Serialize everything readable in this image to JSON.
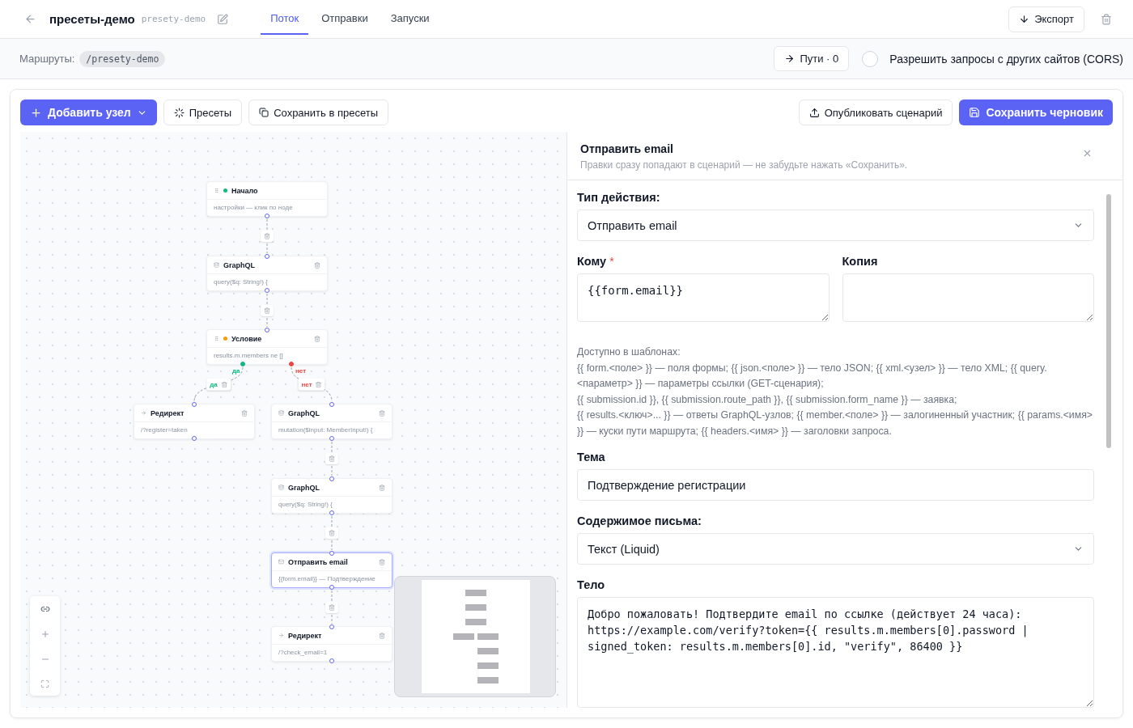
{
  "header": {
    "title": "пресеты-демо",
    "slug": "presety-demo",
    "tabs": [
      {
        "label": "Поток",
        "selected": true
      },
      {
        "label": "Отправки",
        "selected": false
      },
      {
        "label": "Запуски",
        "selected": false
      }
    ],
    "export_button": "Экспорт"
  },
  "routes": {
    "label": "Маршруты:",
    "route": "/presety-demo",
    "paths_button": "Пути · 0",
    "cors": {
      "label": "Разрешить запросы с других сайтов (CORS)",
      "checked": false
    }
  },
  "toolbar": {
    "add_node": "Добавить узел",
    "presets": "Пресеты",
    "save_presets": "Сохранить в пресеты",
    "publish": "Опубликовать сценарий",
    "save_draft": "Сохранить черновик"
  },
  "canvas": {
    "nodes": [
      {
        "kind": "start",
        "title": "Начало",
        "subtitle": "настройки — клик по ноде",
        "color": "#10b981",
        "selected": false
      },
      {
        "kind": "graphql",
        "title": "GraphQL",
        "subtitle": "query($q: String!) {",
        "selected": false
      },
      {
        "kind": "condition",
        "title": "Условие",
        "subtitle": "results.m.members ne []",
        "color": "#f59e0b",
        "selected": false
      },
      {
        "kind": "redirect",
        "title": "Редирект",
        "subtitle": "/?register=taken",
        "selected": false
      },
      {
        "kind": "graphql",
        "title": "GraphQL",
        "subtitle": "mutation($input: MemberInput!) {",
        "selected": false
      },
      {
        "kind": "graphql",
        "title": "GraphQL",
        "subtitle": "query($q: String!) {",
        "selected": false
      },
      {
        "kind": "email",
        "title": "Отправить email",
        "subtitle": "{{form.email}} — Подтверждение",
        "selected": true
      },
      {
        "kind": "redirect",
        "title": "Редирект",
        "subtitle": "/?check_email=1",
        "selected": false
      }
    ],
    "branches": [
      {
        "handle_label": "да",
        "edge_label": "да",
        "color": "#10b981"
      },
      {
        "handle_label": "нет",
        "edge_label": "нет",
        "color": "#ef4444"
      }
    ]
  },
  "panel": {
    "title": "Отправить email",
    "hint": "Правки сразу попадают в сценарий — не забудьте нажать «Сохранить».",
    "action_label": "Тип действия:",
    "action_value": "Отправить email",
    "to_label": "Кому",
    "to_required_mark": "*",
    "to_value": "{{form.email}}",
    "cc_label": "Копия",
    "help_title": "Доступно в шаблонах:",
    "help_lines": [
      "{{ form.<поле> }} — поля формы; {{ json.<поле> }} — тело JSON; {{ xml.<узел> }} — тело XML; {{ query.<параметр> }} — параметры ссылки (GET-сценария);",
      "{{ submission.id }}, {{ submission.route_path }}, {{ submission.form_name }} — заявка;",
      "{{ results.<ключ>... }} — ответы GraphQL-узлов; {{ member.<поле> }} — залогиненный участник; {{ params.<имя> }} — куски пути маршрута; {{ headers.<имя> }} — заголовки запроса."
    ],
    "subject_label": "Тема",
    "subject_value": "Подтверждение регистрации",
    "content_label": "Содержимое письма:",
    "content_value": "Текст (Liquid)",
    "body_label": "Тело",
    "body_value": "Добро пожаловать! Подтвердите email по ссылке (действует 24 часа):\nhttps://example.com/verify?token={{ results.m.members[0].password | signed_token: results.m.members[0].id, \"verify\", 86400 }}"
  }
}
